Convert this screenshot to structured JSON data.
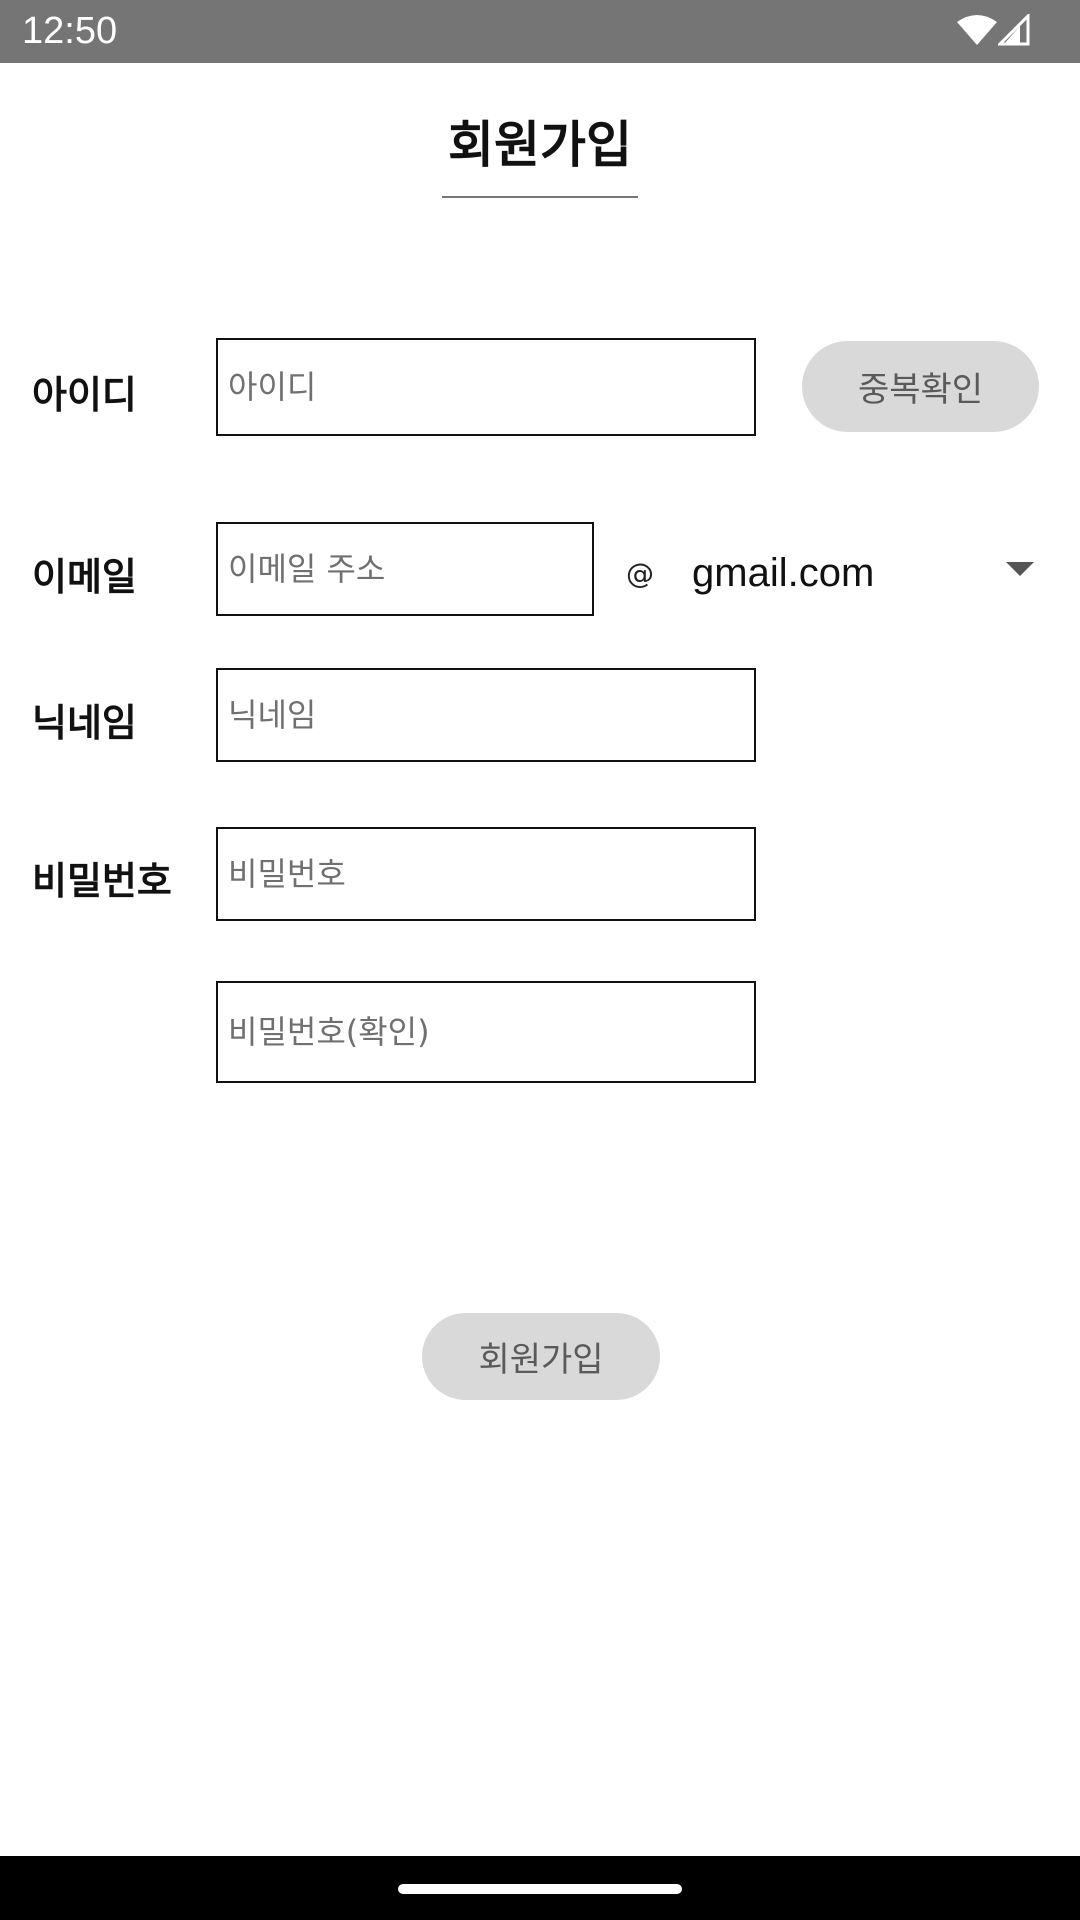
{
  "status_bar": {
    "time": "12:50",
    "icons": [
      "wifi-icon",
      "cell-signal-icon"
    ]
  },
  "header": {
    "title": "회원가입"
  },
  "form": {
    "id": {
      "label": "아이디",
      "placeholder": "아이디",
      "value": "",
      "check_button": "중복확인"
    },
    "email": {
      "label": "이메일",
      "placeholder": "이메일 주소",
      "value": "",
      "at_symbol": "@",
      "domain_selected": "gmail.com"
    },
    "nickname": {
      "label": "닉네임",
      "placeholder": "닉네임",
      "value": ""
    },
    "password": {
      "label": "비밀번호",
      "placeholder": "비밀번호",
      "confirm_placeholder": "비밀번호(확인)",
      "value": ""
    },
    "submit_label": "회원가입"
  },
  "colors": {
    "status_bar_bg": "#757575",
    "button_bg": "#d9d9d9",
    "nav_bar_bg": "#000000"
  }
}
